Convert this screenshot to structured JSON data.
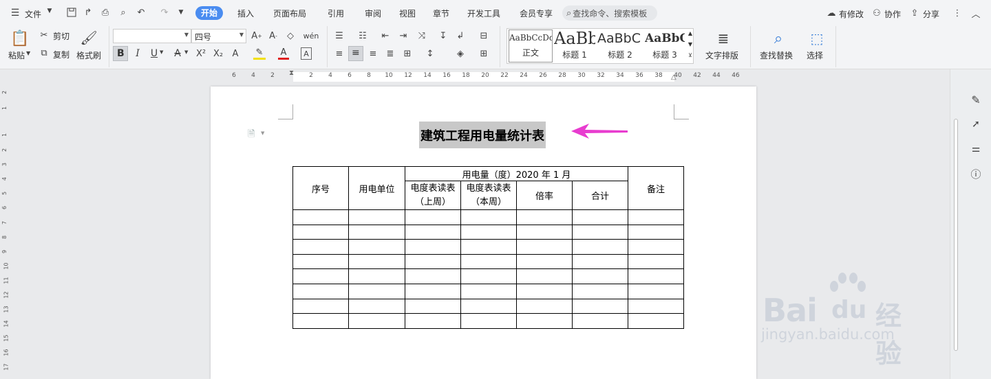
{
  "menubar": {
    "file_label": "文件",
    "tabs": [
      "开始",
      "插入",
      "页面布局",
      "引用",
      "审阅",
      "视图",
      "章节",
      "开发工具",
      "会员专享"
    ],
    "search_placeholder": "查找命令、搜索模板",
    "right": {
      "modified": "有修改",
      "collab": "协作",
      "share": "分享"
    }
  },
  "ribbon": {
    "paste": "粘贴",
    "cut": "剪切",
    "copy": "复制",
    "format_painter": "格式刷",
    "font_name": "",
    "font_size": "四号",
    "styles": [
      {
        "preview": "AaBbCcDd",
        "label": "正文"
      },
      {
        "preview": "AaBb",
        "label": "标题 1"
      },
      {
        "preview": "AaBbC",
        "label": "标题 2"
      },
      {
        "preview": "AaBbC",
        "label": "标题 3"
      }
    ],
    "text_layout": "文字排版",
    "find_replace": "查找替换",
    "select": "选择"
  },
  "ruler": {
    "h_ticks": [
      "6",
      "4",
      "2",
      "2",
      "4",
      "6",
      "8",
      "10",
      "12",
      "14",
      "16",
      "18",
      "20",
      "22",
      "24",
      "26",
      "28",
      "30",
      "32",
      "34",
      "36",
      "38",
      "40",
      "42",
      "44",
      "46"
    ],
    "v_ticks": [
      "2",
      "1",
      "1",
      "2",
      "3",
      "4",
      "5",
      "6",
      "7",
      "8",
      "9",
      "10",
      "11",
      "12",
      "13",
      "14",
      "15",
      "16",
      "17"
    ]
  },
  "document": {
    "title": "建筑工程用电量统计表",
    "table": {
      "seq": "序号",
      "unit": "用电单位",
      "period": "用电量（度）2020 年 1 月",
      "meter_last": "电度表读表（上周）",
      "meter_this": "电度表读表（本周）",
      "ratio": "倍率",
      "total": "合计",
      "remark": "备注",
      "empty_rows": 8
    }
  },
  "colors": {
    "accent": "#4a8cf0",
    "arrow": "#e83ccf",
    "selection": "#c8c8c8"
  },
  "watermark": {
    "brand": "Bai",
    "brand2": "du",
    "cn": "经验",
    "url": "jingyan.baidu.com"
  }
}
